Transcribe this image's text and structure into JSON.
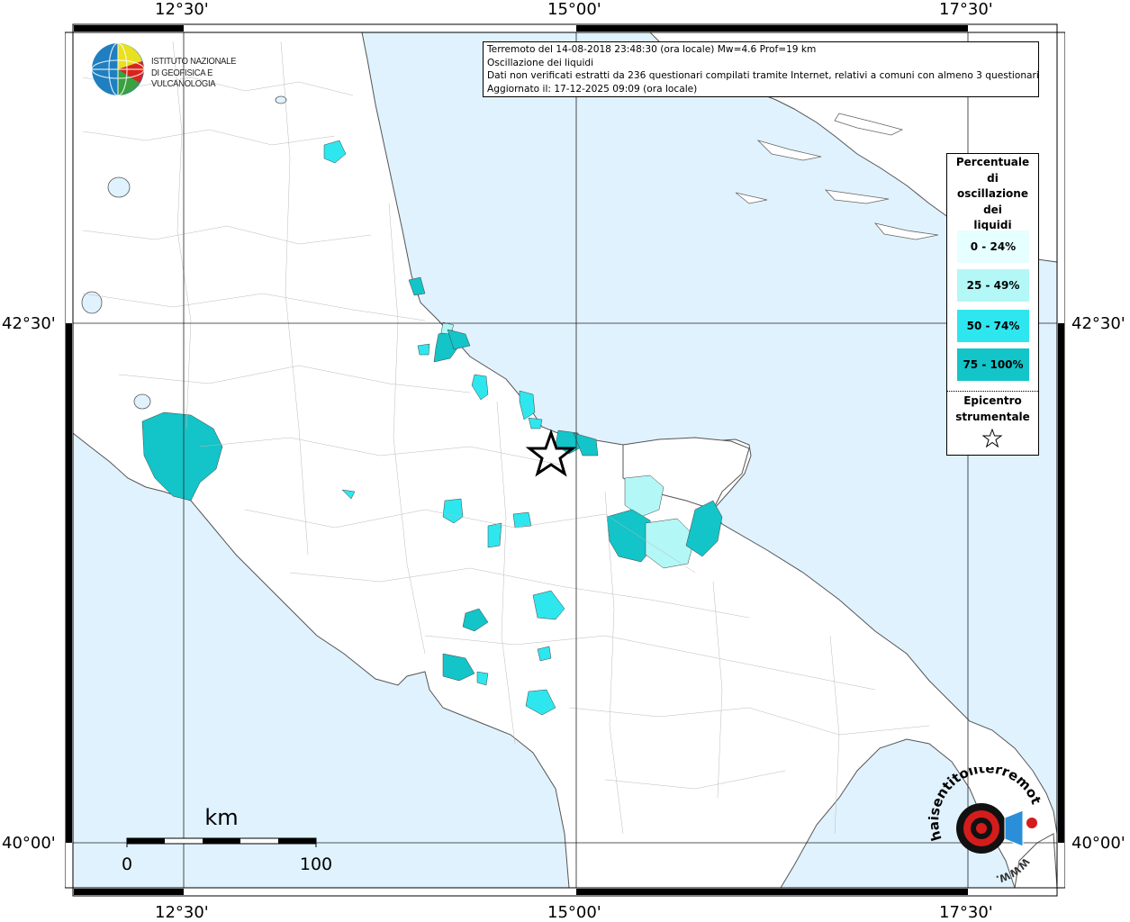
{
  "header": {
    "line1": "Terremoto del 14-08-2018 23:48:30 (ora locale) Mw=4.6 Prof=19 km",
    "line2": "Oscillazione dei liquidi",
    "line3": "Dati non verificati estratti da 236 questionari compilati tramite Internet, relativi a comuni con almeno 3 questionari.",
    "line4": "Aggiornato il: 17-12-2025 09:09 (ora locale)"
  },
  "axes": {
    "lon_labels": [
      "12°30'",
      "15°00'",
      "17°30'"
    ],
    "lat_labels": [
      "42°30'",
      "40°00'"
    ]
  },
  "scale_bar": {
    "unit": "km",
    "min": "0",
    "max": "100"
  },
  "legend": {
    "title_lines": [
      "Percentuale",
      "di",
      "oscillazione",
      "dei",
      "liquidi"
    ],
    "classes": [
      {
        "label": "0 - 24%",
        "color": "#e6ffff"
      },
      {
        "label": "25 - 49%",
        "color": "#b3f7f7"
      },
      {
        "label": "50 - 74%",
        "color": "#2ee6ee"
      },
      {
        "label": "75 - 100%",
        "color": "#13c4c8"
      }
    ],
    "epicenter_lines": [
      "Epicentro",
      "strumentale"
    ]
  },
  "logos": {
    "ingv": [
      "ISTITUTO NAZIONALE",
      "DI GEOFISICA E VULCANOLOGIA"
    ],
    "hsit": {
      "text": "haisentitoilterremoto.it",
      "url_text": "WWW."
    }
  },
  "colors": {
    "sea": "#e0f2fd",
    "land": "#ffffff",
    "border": "#888888"
  },
  "icons": {
    "epicenter": "star-icon",
    "ingv": "globe-icon",
    "hsit": "megaphone-icon"
  }
}
